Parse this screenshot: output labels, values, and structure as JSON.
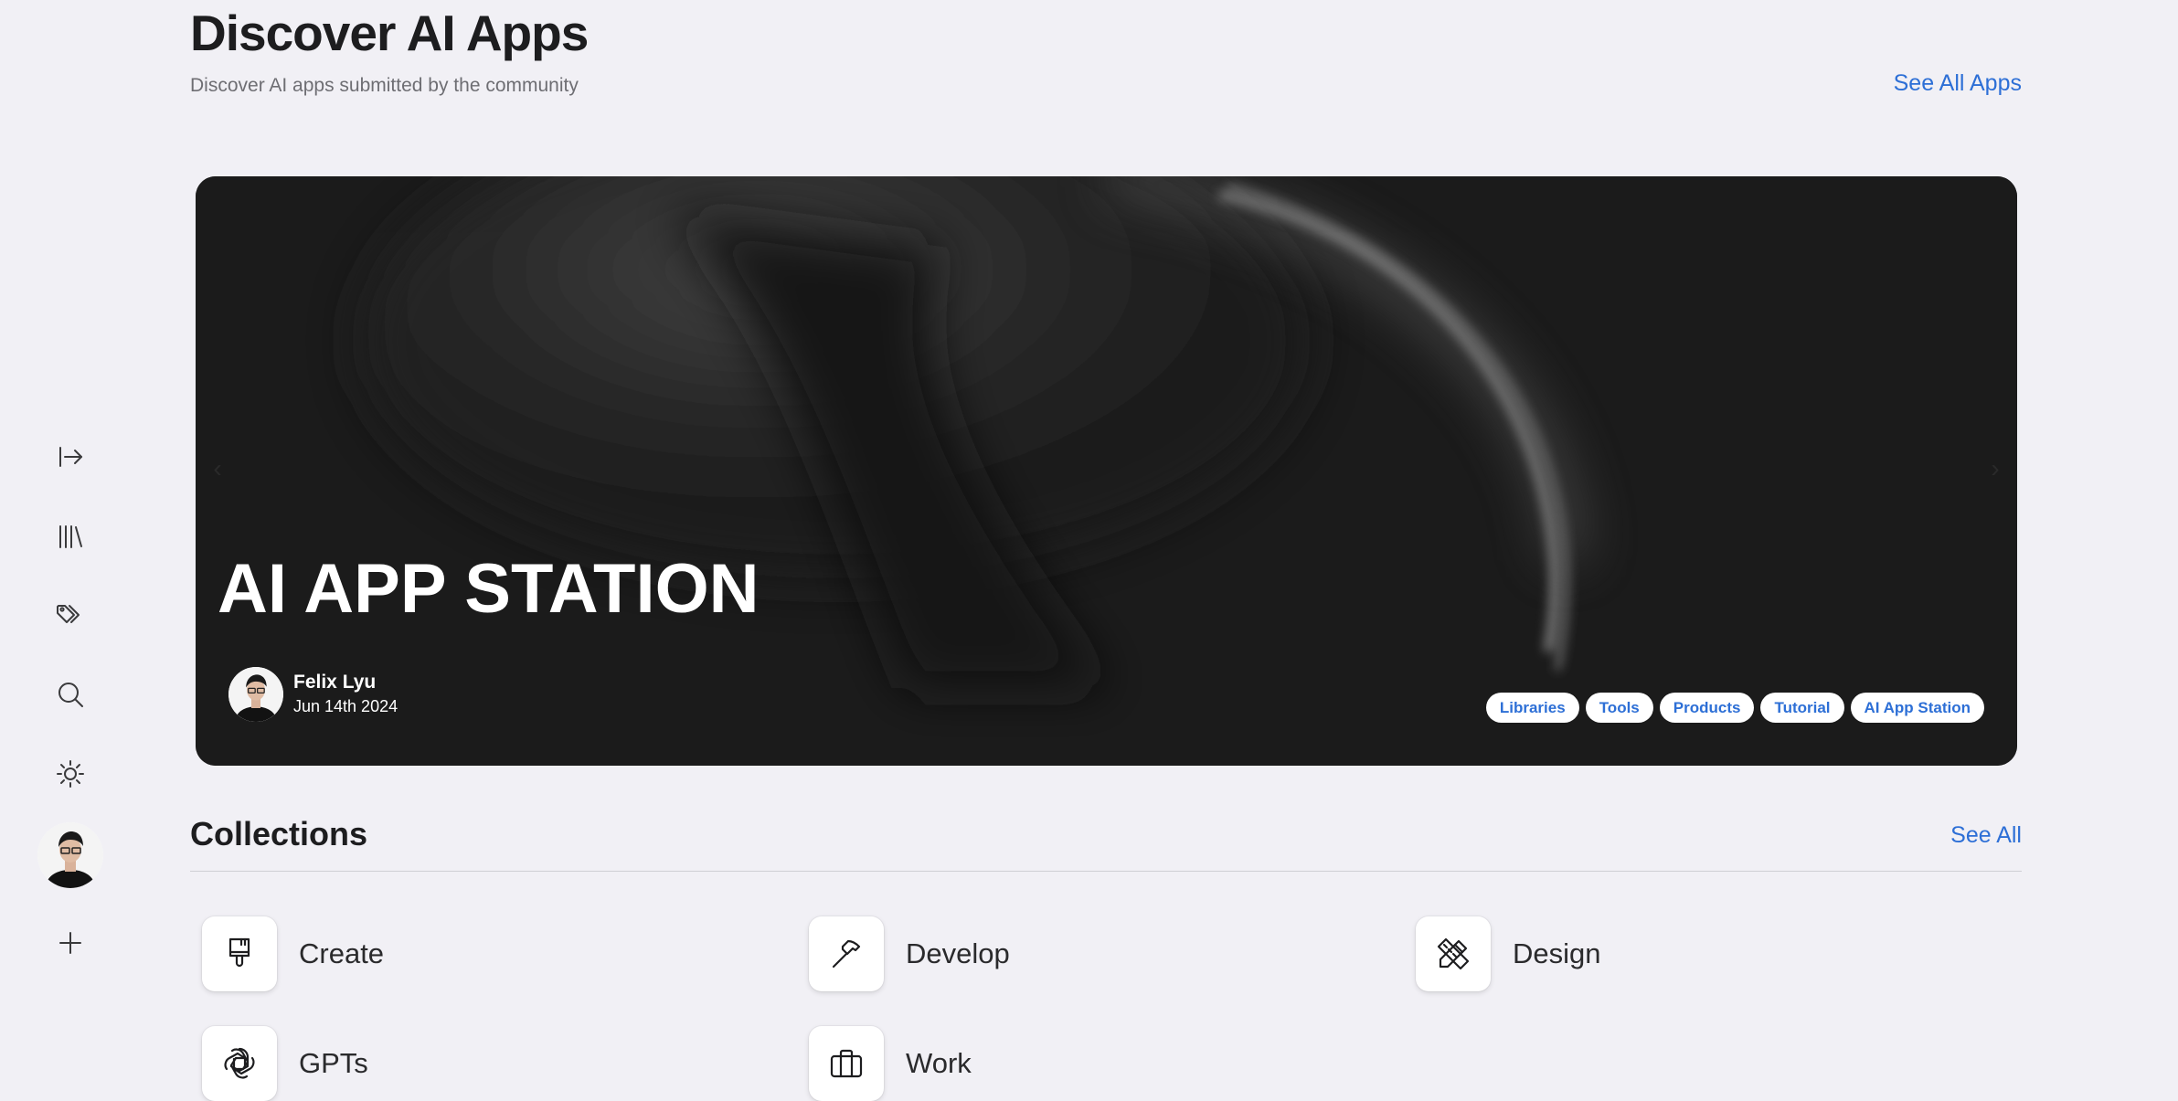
{
  "header": {
    "title": "Discover AI Apps",
    "subtitle": "Discover AI apps submitted by the community",
    "see_all_label": "See All Apps"
  },
  "sidebar": {
    "items": [
      {
        "icon": "expand-sidebar-icon"
      },
      {
        "icon": "library-icon"
      },
      {
        "icon": "tags-icon"
      },
      {
        "icon": "search-icon"
      },
      {
        "icon": "theme-sun-icon"
      },
      {
        "icon": "user-avatar"
      },
      {
        "icon": "plus-icon"
      }
    ]
  },
  "hero": {
    "title": "AI APP STATION",
    "author_name": "Felix Lyu",
    "date": "Jun 14th 2024",
    "tags": [
      "Libraries",
      "Tools",
      "Products",
      "Tutorial",
      "AI App Station"
    ]
  },
  "collections": {
    "title": "Collections",
    "see_all_label": "See All",
    "items": [
      {
        "label": "Create",
        "icon": "paintbrush-icon"
      },
      {
        "label": "Develop",
        "icon": "hammer-icon"
      },
      {
        "label": "Design",
        "icon": "pencil-ruler-icon"
      },
      {
        "label": "GPTs",
        "icon": "openai-icon"
      },
      {
        "label": "Work",
        "icon": "briefcase-icon"
      }
    ]
  },
  "colors": {
    "background": "#f1f0f5",
    "accent": "#2d6fd6",
    "hero_bg": "#1b1b1b"
  }
}
